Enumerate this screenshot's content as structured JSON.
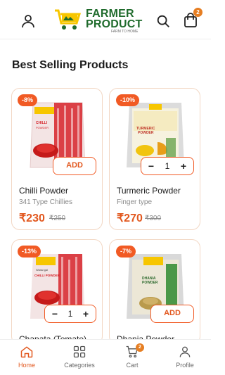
{
  "header": {
    "brand_line1": "FARMER",
    "brand_line2": "PRODUCT",
    "brand_tagline": "FARM TO HOME",
    "cart_count": "2"
  },
  "section": {
    "title": "Best Selling Products"
  },
  "products": [
    {
      "discount": "-8%",
      "name": "Chilli Powder",
      "subtitle": "341 Type Chillies",
      "price": "₹230",
      "mrp": "₹250",
      "action": "ADD",
      "pack_brand": "FARMER PRODUCT",
      "pack_label": "CHILLI POWDER",
      "pack_color": "#d6232a"
    },
    {
      "discount": "-10%",
      "name": "Turmeric Powder",
      "subtitle": "Finger type",
      "price": "₹270",
      "mrp": "₹300",
      "quantity": "1",
      "pack_brand": "FARMER PRODUCT",
      "pack_label": "TURMERIC POWDER",
      "pack_color": "#f1c40f"
    },
    {
      "discount": "-13%",
      "name": "Chapata (Tomato) ...",
      "quantity": "1",
      "pack_brand": "FARMER PRODUCT",
      "pack_label": "CHILLI POWDER",
      "pack_sub": "Warangal",
      "pack_color": "#d6232a"
    },
    {
      "discount": "-7%",
      "name": "Dhania Powder",
      "action": "ADD",
      "pack_brand": "FARMER PRODUCT",
      "pack_label": "DHANIA POWDER",
      "pack_color": "#2f8a2f"
    }
  ],
  "bottom_nav": {
    "items": [
      {
        "label": "Home",
        "active": true
      },
      {
        "label": "Categories"
      },
      {
        "label": "Cart",
        "badge": "2"
      },
      {
        "label": "Profile"
      }
    ]
  },
  "colors": {
    "accent": "#e2581f",
    "discount": "#f15a24",
    "brand_green": "#1f6b2c",
    "brand_yellow": "#f7c600"
  }
}
